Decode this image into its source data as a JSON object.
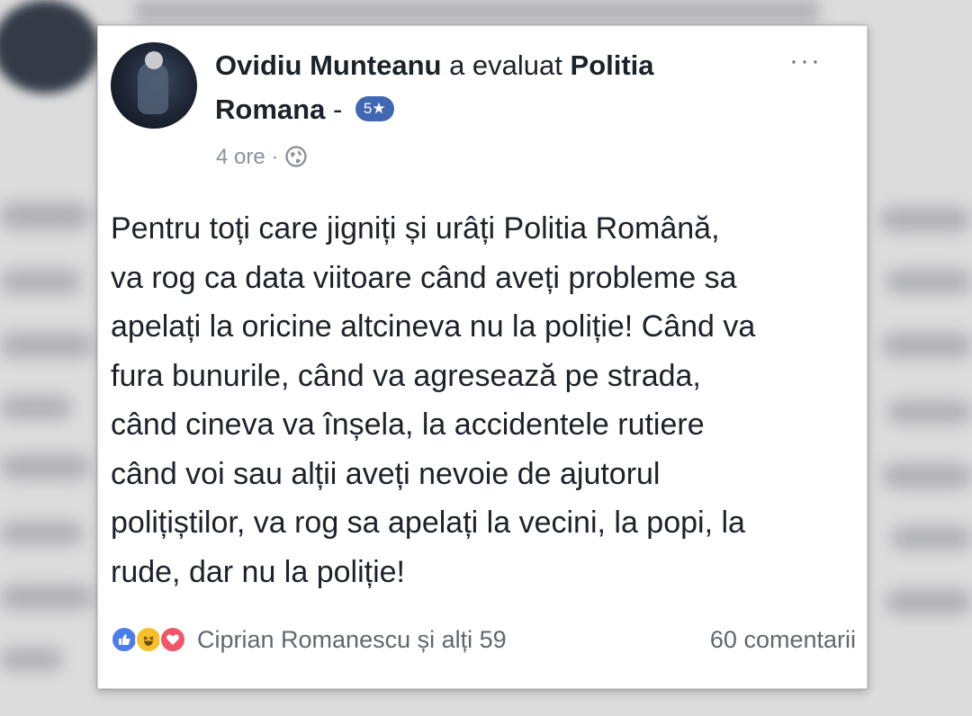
{
  "post": {
    "author": "Ovidiu Munteanu",
    "action": "a evaluat",
    "page_name_1": "Politia",
    "page_name_2": "Romana",
    "separator": "-",
    "rating": "5★",
    "time": "4 ore",
    "dot": "·",
    "audience_icon": "globe-icon",
    "more_label": "···",
    "body_lines": [
      "Pentru toți care jigniți și urâți Politia Română,",
      "va rog ca data viitoare când aveți probleme sa",
      "apelați la oricine altcineva nu la poliție! Când va",
      "fura bunurile, când va agresează pe strada,",
      "când cineva va înșela, la accidentele rutiere",
      "când voi sau alții aveți nevoie de ajutorul",
      "polițiștilor, va rog sa apelați la vecini, la popi, la",
      "rude, dar nu la poliție!"
    ]
  },
  "footer": {
    "reactions": [
      "like-icon",
      "haha-icon",
      "love-icon"
    ],
    "reactors_text": "Ciprian Romanescu și alți 59",
    "comments_text": "60 comentarii"
  },
  "colors": {
    "brand_blue": "#4267b2",
    "text_primary": "#1d2129",
    "text_secondary": "#62666e"
  }
}
